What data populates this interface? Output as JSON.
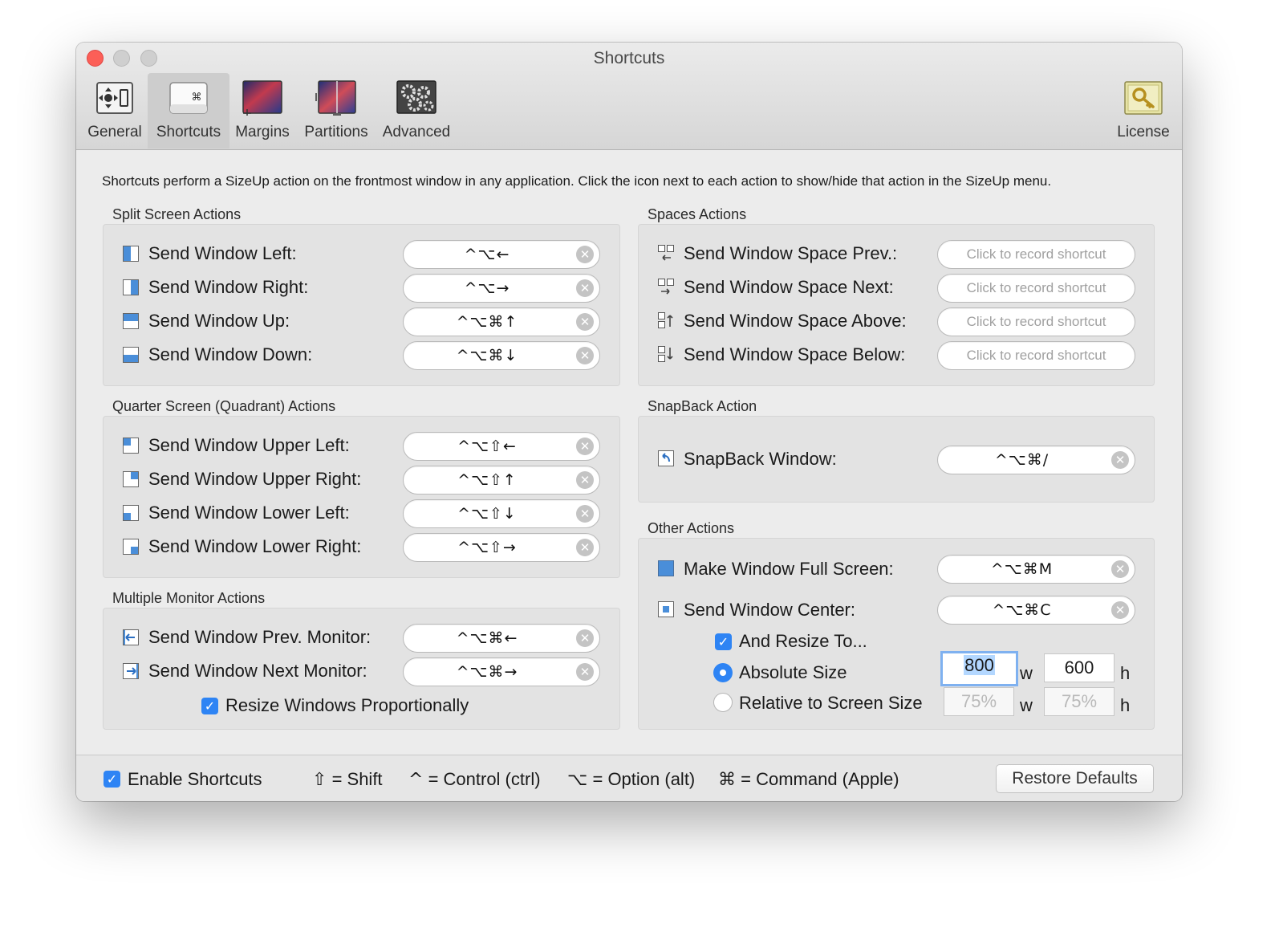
{
  "window": {
    "title": "Shortcuts"
  },
  "toolbar": {
    "general": "General",
    "shortcuts": "Shortcuts",
    "margins": "Margins",
    "partitions": "Partitions",
    "advanced": "Advanced",
    "license": "License"
  },
  "intro": "Shortcuts perform a SizeUp action on the frontmost window in any application. Click the icon next to each action to show/hide that action in the SizeUp menu.",
  "split": {
    "title": "Split Screen Actions",
    "rows": [
      {
        "label": "Send Window Left:",
        "keys": "^⌥←"
      },
      {
        "label": "Send Window Right:",
        "keys": "^⌥→"
      },
      {
        "label": "Send Window Up:",
        "keys": "^⌥⌘↑"
      },
      {
        "label": "Send Window Down:",
        "keys": "^⌥⌘↓"
      }
    ]
  },
  "quarter": {
    "title": "Quarter Screen (Quadrant) Actions",
    "rows": [
      {
        "label": "Send Window Upper Left:",
        "keys": "^⌥⇧←"
      },
      {
        "label": "Send Window Upper Right:",
        "keys": "^⌥⇧↑"
      },
      {
        "label": "Send Window Lower Left:",
        "keys": "^⌥⇧↓"
      },
      {
        "label": "Send Window Lower Right:",
        "keys": "^⌥⇧→"
      }
    ]
  },
  "monitor": {
    "title": "Multiple Monitor Actions",
    "rows": [
      {
        "label": "Send Window Prev. Monitor:",
        "keys": "^⌥⌘←"
      },
      {
        "label": "Send Window Next Monitor:",
        "keys": "^⌥⌘→"
      }
    ],
    "resize_label": "Resize Windows Proportionally"
  },
  "spaces": {
    "title": "Spaces Actions",
    "placeholder": "Click to record shortcut",
    "rows": [
      {
        "label": "Send Window Space Prev.:"
      },
      {
        "label": "Send Window Space Next:"
      },
      {
        "label": "Send Window Space Above:"
      },
      {
        "label": "Send Window Space Below:"
      }
    ]
  },
  "snapback": {
    "title": "SnapBack Action",
    "label": "SnapBack Window:",
    "keys": "^⌥⌘/"
  },
  "other": {
    "title": "Other Actions",
    "fullscreen": {
      "label": "Make Window Full Screen:",
      "keys": "^⌥⌘M"
    },
    "center": {
      "label": "Send Window Center:",
      "keys": "^⌥⌘C"
    },
    "resize_to": "And Resize To...",
    "absolute": "Absolute Size",
    "relative": "Relative to Screen Size",
    "abs_w": "800",
    "abs_h": "600",
    "rel_w": "75%",
    "rel_h": "75%",
    "w_unit": "w",
    "h_unit": "h"
  },
  "bottom": {
    "enable": "Enable Shortcuts",
    "shift_sym": "⇧",
    "shift": "= Shift",
    "ctrl_sym": "^",
    "ctrl": "= Control (ctrl)",
    "opt_sym": "⌥",
    "opt": "= Option (alt)",
    "cmd_sym": "⌘",
    "cmd": "= Command (Apple)",
    "restore": "Restore Defaults"
  },
  "checkmark": "✓",
  "clear_glyph": "✕",
  "colors": {
    "accent": "#2e84f4",
    "close": "#fc5f57",
    "panel": "#e3e3e3"
  }
}
